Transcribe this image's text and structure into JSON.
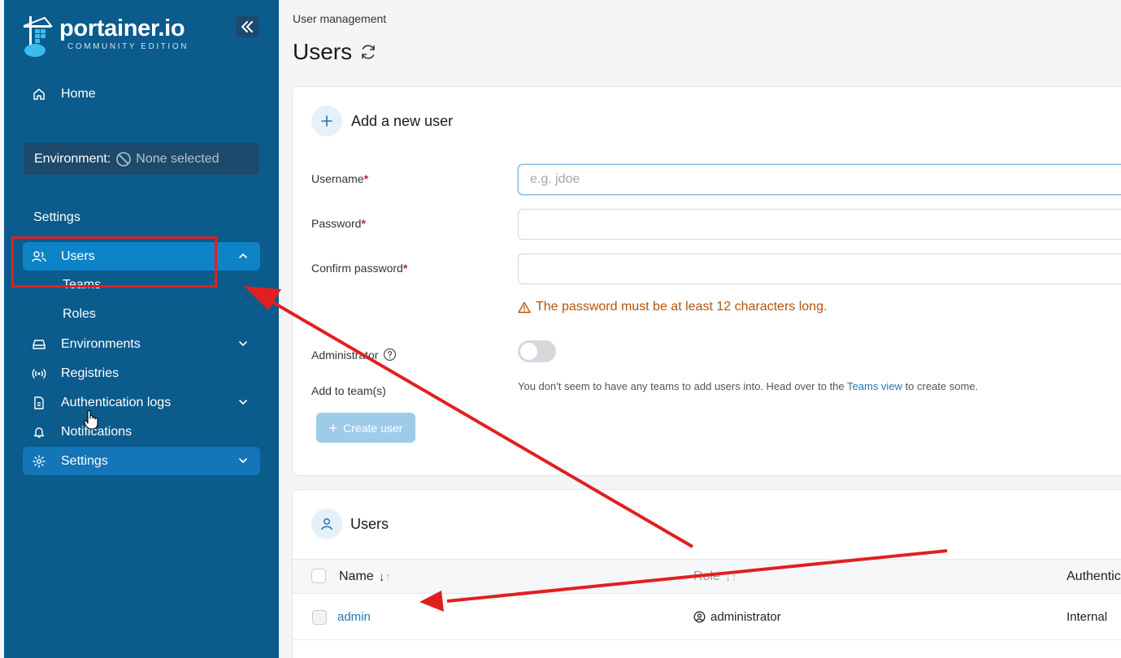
{
  "brand": {
    "name": "portainer.io",
    "edition": "COMMUNITY EDITION"
  },
  "sidebar": {
    "home": "Home",
    "environment_label": "Environment:",
    "environment_value": "None selected",
    "section": "Settings",
    "users": "Users",
    "teams": "Teams",
    "roles": "Roles",
    "environments": "Environments",
    "registries": "Registries",
    "auth_logs": "Authentication logs",
    "notifications": "Notifications",
    "settings": "Settings"
  },
  "page": {
    "breadcrumb": "User management",
    "title": "Users"
  },
  "add_user": {
    "title": "Add a new user",
    "username_label": "Username",
    "username_placeholder": "e.g. jdoe",
    "password_label": "Password",
    "confirm_label": "Confirm password",
    "required_mark": "*",
    "warning": "The password must be at least 12 characters long.",
    "admin_label": "Administrator",
    "admin_enabled": false,
    "team_label": "Add to team(s)",
    "team_hint_before": "You don't seem to have any teams to add users into. Head over to the ",
    "team_hint_link": "Teams view",
    "team_hint_after": " to create some.",
    "create_button": "Create user"
  },
  "users_table": {
    "title": "Users",
    "columns": {
      "name": "Name",
      "role": "Role",
      "auth": "Authentication"
    },
    "rows": [
      {
        "name": "admin",
        "role": "administrator",
        "auth": "Internal"
      }
    ]
  },
  "colors": {
    "sidebar": "#0b5b8d",
    "sidebar_active": "#0d84c8",
    "annotation": "#e02020"
  }
}
